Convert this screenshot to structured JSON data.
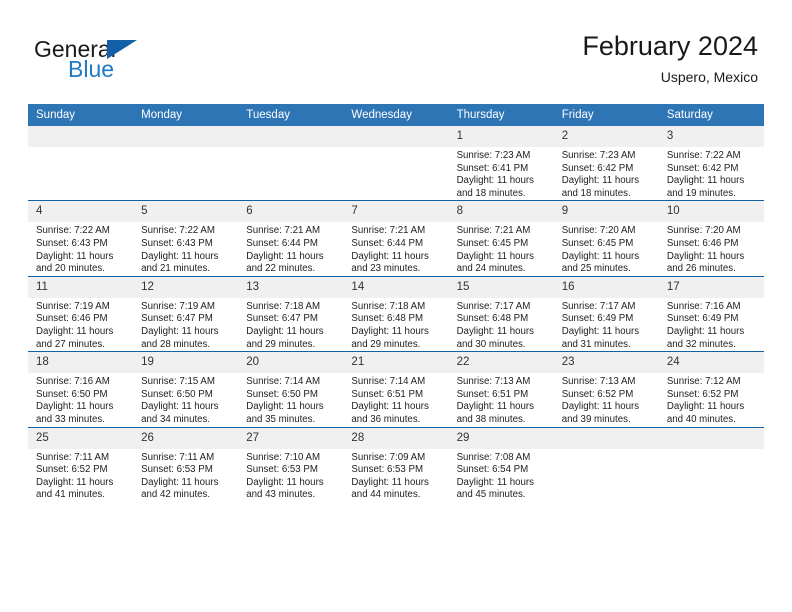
{
  "brand": {
    "name_part1": "General",
    "name_part2": "Blue",
    "logo_icon": "blue-triangle-icon"
  },
  "header": {
    "month_title": "February 2024",
    "location": "Uspero, Mexico"
  },
  "colors": {
    "header_blue": "#2e75b6",
    "rule_blue": "#1261a8",
    "daynum_band": "#f0f0f0",
    "brand_blue": "#1f79c4"
  },
  "weekday_headers": [
    "Sunday",
    "Monday",
    "Tuesday",
    "Wednesday",
    "Thursday",
    "Friday",
    "Saturday"
  ],
  "weeks": [
    [
      {
        "day": "",
        "empty": true,
        "sunrise": "",
        "sunset": "",
        "daylight_line1": "",
        "daylight_line2": ""
      },
      {
        "day": "",
        "empty": true,
        "sunrise": "",
        "sunset": "",
        "daylight_line1": "",
        "daylight_line2": ""
      },
      {
        "day": "",
        "empty": true,
        "sunrise": "",
        "sunset": "",
        "daylight_line1": "",
        "daylight_line2": ""
      },
      {
        "day": "",
        "empty": true,
        "sunrise": "",
        "sunset": "",
        "daylight_line1": "",
        "daylight_line2": ""
      },
      {
        "day": "1",
        "empty": false,
        "sunrise": "Sunrise: 7:23 AM",
        "sunset": "Sunset: 6:41 PM",
        "daylight_line1": "Daylight: 11 hours",
        "daylight_line2": "and 18 minutes."
      },
      {
        "day": "2",
        "empty": false,
        "sunrise": "Sunrise: 7:23 AM",
        "sunset": "Sunset: 6:42 PM",
        "daylight_line1": "Daylight: 11 hours",
        "daylight_line2": "and 18 minutes."
      },
      {
        "day": "3",
        "empty": false,
        "sunrise": "Sunrise: 7:22 AM",
        "sunset": "Sunset: 6:42 PM",
        "daylight_line1": "Daylight: 11 hours",
        "daylight_line2": "and 19 minutes."
      }
    ],
    [
      {
        "day": "4",
        "empty": false,
        "sunrise": "Sunrise: 7:22 AM",
        "sunset": "Sunset: 6:43 PM",
        "daylight_line1": "Daylight: 11 hours",
        "daylight_line2": "and 20 minutes."
      },
      {
        "day": "5",
        "empty": false,
        "sunrise": "Sunrise: 7:22 AM",
        "sunset": "Sunset: 6:43 PM",
        "daylight_line1": "Daylight: 11 hours",
        "daylight_line2": "and 21 minutes."
      },
      {
        "day": "6",
        "empty": false,
        "sunrise": "Sunrise: 7:21 AM",
        "sunset": "Sunset: 6:44 PM",
        "daylight_line1": "Daylight: 11 hours",
        "daylight_line2": "and 22 minutes."
      },
      {
        "day": "7",
        "empty": false,
        "sunrise": "Sunrise: 7:21 AM",
        "sunset": "Sunset: 6:44 PM",
        "daylight_line1": "Daylight: 11 hours",
        "daylight_line2": "and 23 minutes."
      },
      {
        "day": "8",
        "empty": false,
        "sunrise": "Sunrise: 7:21 AM",
        "sunset": "Sunset: 6:45 PM",
        "daylight_line1": "Daylight: 11 hours",
        "daylight_line2": "and 24 minutes."
      },
      {
        "day": "9",
        "empty": false,
        "sunrise": "Sunrise: 7:20 AM",
        "sunset": "Sunset: 6:45 PM",
        "daylight_line1": "Daylight: 11 hours",
        "daylight_line2": "and 25 minutes."
      },
      {
        "day": "10",
        "empty": false,
        "sunrise": "Sunrise: 7:20 AM",
        "sunset": "Sunset: 6:46 PM",
        "daylight_line1": "Daylight: 11 hours",
        "daylight_line2": "and 26 minutes."
      }
    ],
    [
      {
        "day": "11",
        "empty": false,
        "sunrise": "Sunrise: 7:19 AM",
        "sunset": "Sunset: 6:46 PM",
        "daylight_line1": "Daylight: 11 hours",
        "daylight_line2": "and 27 minutes."
      },
      {
        "day": "12",
        "empty": false,
        "sunrise": "Sunrise: 7:19 AM",
        "sunset": "Sunset: 6:47 PM",
        "daylight_line1": "Daylight: 11 hours",
        "daylight_line2": "and 28 minutes."
      },
      {
        "day": "13",
        "empty": false,
        "sunrise": "Sunrise: 7:18 AM",
        "sunset": "Sunset: 6:47 PM",
        "daylight_line1": "Daylight: 11 hours",
        "daylight_line2": "and 29 minutes."
      },
      {
        "day": "14",
        "empty": false,
        "sunrise": "Sunrise: 7:18 AM",
        "sunset": "Sunset: 6:48 PM",
        "daylight_line1": "Daylight: 11 hours",
        "daylight_line2": "and 29 minutes."
      },
      {
        "day": "15",
        "empty": false,
        "sunrise": "Sunrise: 7:17 AM",
        "sunset": "Sunset: 6:48 PM",
        "daylight_line1": "Daylight: 11 hours",
        "daylight_line2": "and 30 minutes."
      },
      {
        "day": "16",
        "empty": false,
        "sunrise": "Sunrise: 7:17 AM",
        "sunset": "Sunset: 6:49 PM",
        "daylight_line1": "Daylight: 11 hours",
        "daylight_line2": "and 31 minutes."
      },
      {
        "day": "17",
        "empty": false,
        "sunrise": "Sunrise: 7:16 AM",
        "sunset": "Sunset: 6:49 PM",
        "daylight_line1": "Daylight: 11 hours",
        "daylight_line2": "and 32 minutes."
      }
    ],
    [
      {
        "day": "18",
        "empty": false,
        "sunrise": "Sunrise: 7:16 AM",
        "sunset": "Sunset: 6:50 PM",
        "daylight_line1": "Daylight: 11 hours",
        "daylight_line2": "and 33 minutes."
      },
      {
        "day": "19",
        "empty": false,
        "sunrise": "Sunrise: 7:15 AM",
        "sunset": "Sunset: 6:50 PM",
        "daylight_line1": "Daylight: 11 hours",
        "daylight_line2": "and 34 minutes."
      },
      {
        "day": "20",
        "empty": false,
        "sunrise": "Sunrise: 7:14 AM",
        "sunset": "Sunset: 6:50 PM",
        "daylight_line1": "Daylight: 11 hours",
        "daylight_line2": "and 35 minutes."
      },
      {
        "day": "21",
        "empty": false,
        "sunrise": "Sunrise: 7:14 AM",
        "sunset": "Sunset: 6:51 PM",
        "daylight_line1": "Daylight: 11 hours",
        "daylight_line2": "and 36 minutes."
      },
      {
        "day": "22",
        "empty": false,
        "sunrise": "Sunrise: 7:13 AM",
        "sunset": "Sunset: 6:51 PM",
        "daylight_line1": "Daylight: 11 hours",
        "daylight_line2": "and 38 minutes."
      },
      {
        "day": "23",
        "empty": false,
        "sunrise": "Sunrise: 7:13 AM",
        "sunset": "Sunset: 6:52 PM",
        "daylight_line1": "Daylight: 11 hours",
        "daylight_line2": "and 39 minutes."
      },
      {
        "day": "24",
        "empty": false,
        "sunrise": "Sunrise: 7:12 AM",
        "sunset": "Sunset: 6:52 PM",
        "daylight_line1": "Daylight: 11 hours",
        "daylight_line2": "and 40 minutes."
      }
    ],
    [
      {
        "day": "25",
        "empty": false,
        "sunrise": "Sunrise: 7:11 AM",
        "sunset": "Sunset: 6:52 PM",
        "daylight_line1": "Daylight: 11 hours",
        "daylight_line2": "and 41 minutes."
      },
      {
        "day": "26",
        "empty": false,
        "sunrise": "Sunrise: 7:11 AM",
        "sunset": "Sunset: 6:53 PM",
        "daylight_line1": "Daylight: 11 hours",
        "daylight_line2": "and 42 minutes."
      },
      {
        "day": "27",
        "empty": false,
        "sunrise": "Sunrise: 7:10 AM",
        "sunset": "Sunset: 6:53 PM",
        "daylight_line1": "Daylight: 11 hours",
        "daylight_line2": "and 43 minutes."
      },
      {
        "day": "28",
        "empty": false,
        "sunrise": "Sunrise: 7:09 AM",
        "sunset": "Sunset: 6:53 PM",
        "daylight_line1": "Daylight: 11 hours",
        "daylight_line2": "and 44 minutes."
      },
      {
        "day": "29",
        "empty": false,
        "sunrise": "Sunrise: 7:08 AM",
        "sunset": "Sunset: 6:54 PM",
        "daylight_line1": "Daylight: 11 hours",
        "daylight_line2": "and 45 minutes."
      },
      {
        "day": "",
        "empty": true,
        "sunrise": "",
        "sunset": "",
        "daylight_line1": "",
        "daylight_line2": ""
      },
      {
        "day": "",
        "empty": true,
        "sunrise": "",
        "sunset": "",
        "daylight_line1": "",
        "daylight_line2": ""
      }
    ]
  ]
}
